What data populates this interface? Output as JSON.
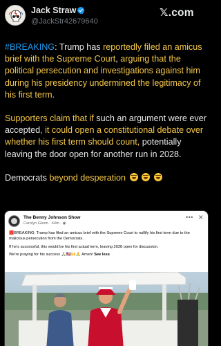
{
  "author": {
    "display_name": "Jack Straw",
    "handle": "@JackStr42679640",
    "avatar_icon": "avatar-image",
    "verified_icon": "verified-badge-icon"
  },
  "brand": {
    "logo_x": "𝕏",
    "logo_suffix": ".com"
  },
  "tweet": {
    "p1_tag": "#BREAKING",
    "p1_a": ": Trump has ",
    "p1_b": "reportedly filed an amicus brief with the Supreme Court",
    "p1_c": ", ",
    "p1_d": "arguing that the political persecution and investigations against him during his presidency undermined the legitimacy of his first term.",
    "p2_a": "Supporters claim that if ",
    "p2_b": "such an argument were ever accepted",
    "p2_c": ", it could open a constitutional debate over whether his first term should count, ",
    "p2_d": "potentially leaving the door open for another run in 2028.",
    "p3_a": "Democrats",
    "p3_b": " beyond desperation",
    "emoji_name": "rolling-on-floor-laughing-emoji"
  },
  "embed": {
    "page_name": "The Benny Johnson Show",
    "sub_line": "Carolyn Glenn · 44m · ",
    "more_label": "•••",
    "close_label": "✕",
    "line1": "🟥BREAKING: Trump has filed an amicus brief with the Supreme Court to nullify his first term due to the malicious persecution from the Democrats.",
    "line2": "If he's successful, this would be his first actual term, leaving 2028 open for discussion.",
    "line3": "We're praying for his success 🙏🇺🇸🙌🙏 Amen! ",
    "see_less": "See less"
  },
  "colors": {
    "background": "#000000",
    "text": "#e7e9ea",
    "muted": "#71767b",
    "highlight": "#f6c84a",
    "hashtag": "#1d9bf0",
    "verified": "#1d9bf0"
  }
}
